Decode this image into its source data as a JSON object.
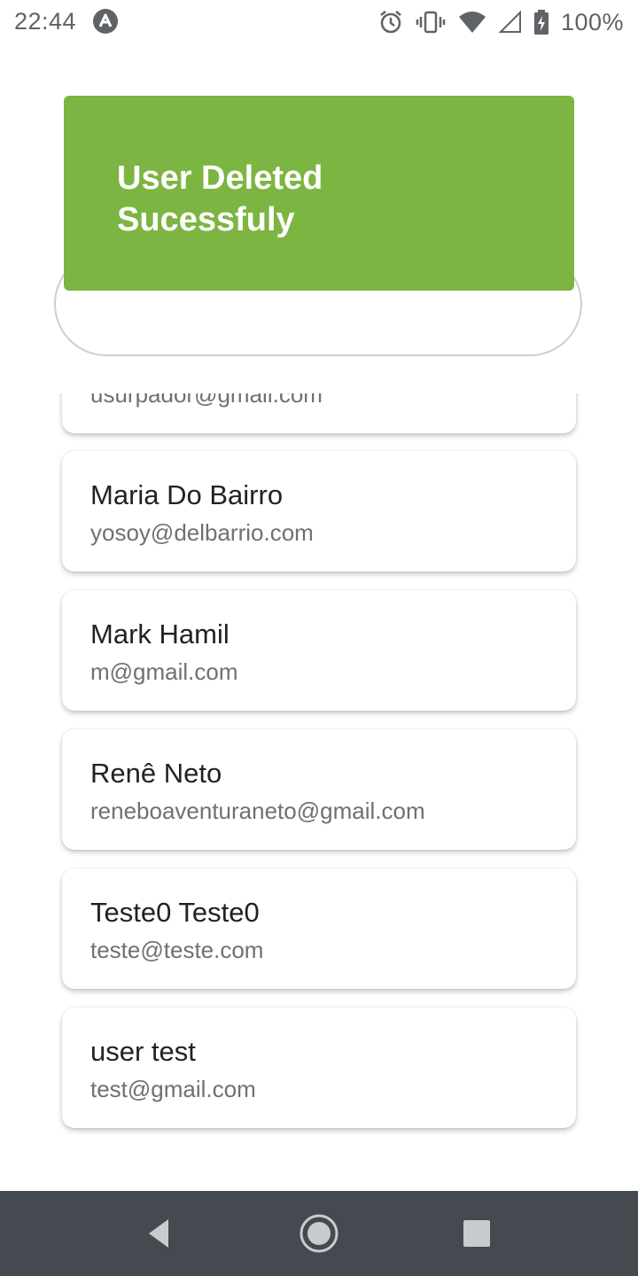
{
  "status_bar": {
    "time": "22:44",
    "battery": "100%",
    "icons": [
      "app-notification-icon",
      "alarm-icon",
      "vibrate-icon",
      "wifi-icon",
      "signal-icon",
      "battery-charging-icon"
    ]
  },
  "toast": {
    "message": "User Deleted Sucessfuly",
    "color": "#7cb541"
  },
  "users": [
    {
      "name": "",
      "email": "usurpador@gmail.com"
    },
    {
      "name": "Maria Do Bairro",
      "email": "yosoy@delbarrio.com"
    },
    {
      "name": "Mark Hamil",
      "email": "m@gmail.com"
    },
    {
      "name": "Renê Neto",
      "email": "reneboaventuraneto@gmail.com"
    },
    {
      "name": "Teste0 Teste0",
      "email": "teste@teste.com"
    },
    {
      "name": "user test",
      "email": "test@gmail.com"
    }
  ],
  "nav_bar": {
    "icons": [
      "back-icon",
      "home-icon",
      "recents-icon"
    ]
  }
}
